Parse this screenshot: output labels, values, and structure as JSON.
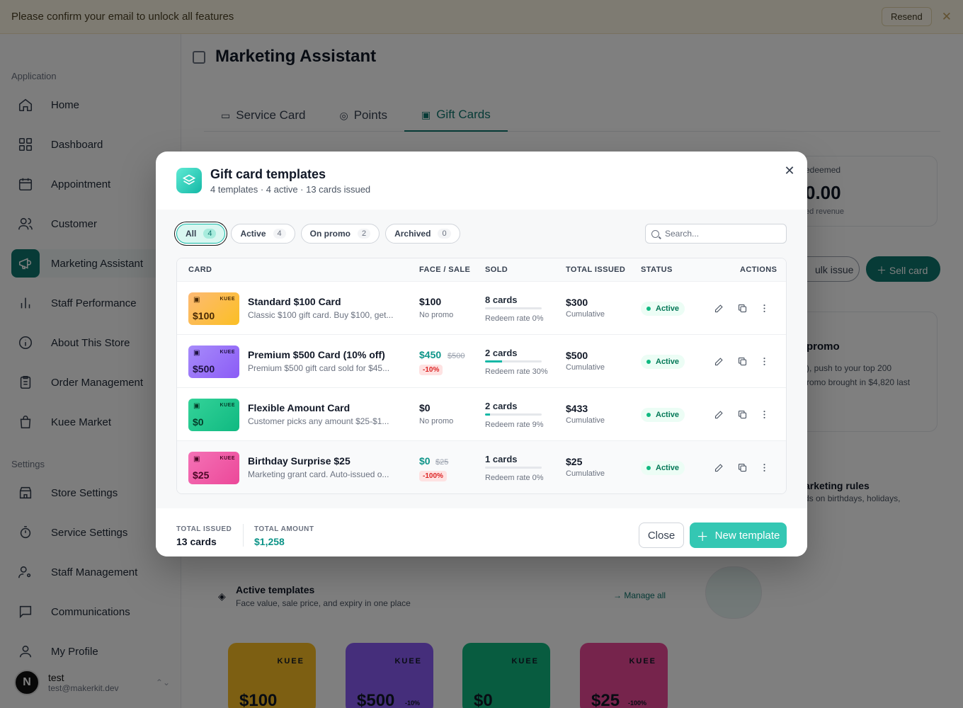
{
  "banner": {
    "text": "Please confirm your email to unlock all features",
    "resend": "Resend"
  },
  "sidebar": {
    "section_app": "Application",
    "section_settings": "Settings",
    "items": [
      {
        "label": "Home",
        "icon": "home-icon"
      },
      {
        "label": "Dashboard",
        "icon": "dashboard-icon"
      },
      {
        "label": "Appointment",
        "icon": "calendar-icon"
      },
      {
        "label": "Customer",
        "icon": "users-icon"
      },
      {
        "label": "Marketing Assistant",
        "icon": "megaphone-icon",
        "active": true
      },
      {
        "label": "Staff Performance",
        "icon": "bar-chart-icon"
      },
      {
        "label": "About This Store",
        "icon": "info-icon"
      },
      {
        "label": "Order Management",
        "icon": "clipboard-icon"
      },
      {
        "label": "Kuee Market",
        "icon": "shopping-bag-icon"
      }
    ],
    "settings_items": [
      {
        "label": "Store Settings",
        "icon": "store-icon"
      },
      {
        "label": "Service Settings",
        "icon": "timer-icon"
      },
      {
        "label": "Staff Management",
        "icon": "user-cog-icon"
      },
      {
        "label": "Communications",
        "icon": "message-icon"
      },
      {
        "label": "My Profile",
        "icon": "user-icon"
      }
    ],
    "user": {
      "initial": "N",
      "name": "test",
      "email": "test@makerkit.dev"
    }
  },
  "main": {
    "title": "Marketing Assistant",
    "tabs": [
      {
        "label": "Service Card"
      },
      {
        "label": "Points"
      },
      {
        "label": "Gift Cards",
        "active": true
      }
    ],
    "bg_redeemed_label": "edeemed",
    "bg_redeemed_value": "0.00",
    "bg_redeemed_sub": "ed revenue",
    "bg_bulk": "ulk issue",
    "bg_sell": "Sell card",
    "bg_promo_title": "promo",
    "bg_promo_text1": "), push to your top 200",
    "bg_promo_text2": "romo brought in $4,820 last",
    "bg_rules_title": "arketing rules",
    "bg_rules_text": "ds on birthdays, holidays,",
    "bg_active_title": "Active templates",
    "bg_active_sub": "Face value, sale price, and expiry in one place",
    "bg_manage": "Manage all",
    "bg_cards": [
      {
        "brand": "KUEE",
        "amount": "$100"
      },
      {
        "brand": "KUEE",
        "amount": "$500",
        "badge": "-10%"
      },
      {
        "brand": "KUEE",
        "amount": "$0"
      },
      {
        "brand": "KUEE",
        "amount": "$25",
        "badge": "-100%"
      }
    ]
  },
  "modal": {
    "title": "Gift card templates",
    "subtitle": "4 templates · 4 active · 13 cards issued",
    "filters": [
      {
        "label": "All",
        "count": "4",
        "active": true
      },
      {
        "label": "Active",
        "count": "4"
      },
      {
        "label": "On promo",
        "count": "2"
      },
      {
        "label": "Archived",
        "count": "0"
      }
    ],
    "search_placeholder": "Search...",
    "columns": [
      "CARD",
      "FACE / SALE",
      "SOLD",
      "TOTAL ISSUED",
      "STATUS",
      "ACTIONS"
    ],
    "rows": [
      {
        "theme": "orange",
        "brand": "KUEE",
        "amount": "$100",
        "name": "Standard $100 Card",
        "desc": "Classic $100 gift card. Buy $100, get...",
        "face": "$100",
        "old": "",
        "face_sub": "No promo",
        "badge": "",
        "sold": "8 cards",
        "redeem_rate": 0,
        "redeem": "Redeem rate 0%",
        "total": "$300",
        "total_sub": "Cumulative",
        "status": "Active"
      },
      {
        "theme": "purple",
        "brand": "KUEE",
        "amount": "$500",
        "name": "Premium $500 Card (10% off)",
        "desc": "Premium $500 gift card sold for $45...",
        "face": "$450",
        "old": "$500",
        "face_sub": "",
        "badge": "-10%",
        "sold": "2 cards",
        "redeem_rate": 30,
        "redeem": "Redeem rate 30%",
        "total": "$500",
        "total_sub": "Cumulative",
        "status": "Active"
      },
      {
        "theme": "green",
        "brand": "KUEE",
        "amount": "$0",
        "name": "Flexible Amount Card",
        "desc": "Customer picks any amount $25-$1...",
        "face": "$0",
        "old": "",
        "face_sub": "No promo",
        "badge": "",
        "sold": "2 cards",
        "redeem_rate": 9,
        "redeem": "Redeem rate 9%",
        "total": "$433",
        "total_sub": "Cumulative",
        "status": "Active"
      },
      {
        "theme": "pink",
        "brand": "KUEE",
        "amount": "$25",
        "name": "Birthday Surprise $25",
        "desc": "Marketing grant card. Auto-issued o...",
        "face": "$0",
        "old": "$25",
        "face_sub": "",
        "badge": "-100%",
        "sold": "1 cards",
        "redeem_rate": 0,
        "redeem": "Redeem rate 0%",
        "total": "$25",
        "total_sub": "Cumulative",
        "status": "Active"
      }
    ],
    "footer": {
      "issued_label": "TOTAL ISSUED",
      "issued_value": "13 cards",
      "amount_label": "TOTAL AMOUNT",
      "amount_value": "$1,258",
      "close": "Close",
      "new": "New template"
    }
  }
}
